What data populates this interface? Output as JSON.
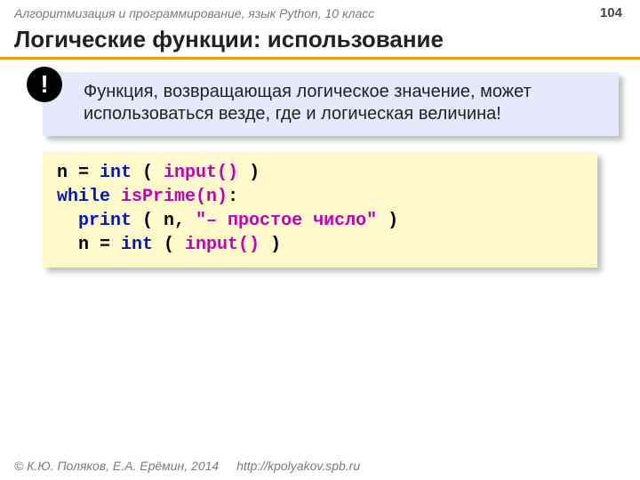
{
  "header": {
    "course": "Алгоритмизация и программирование, язык Python, 10 класс",
    "page": "104"
  },
  "title": "Логические функции: использование",
  "callout": {
    "bang": "!",
    "text": "Функция, возвращающая логическое значение, может использоваться везде, где и логическая величина!"
  },
  "code": {
    "l1": {
      "a": "n = ",
      "b": "int",
      "c": " ( ",
      "d": "input()",
      "e": " )"
    },
    "l2": {
      "a": "while",
      "b": " ",
      "c": "isPrime(n)",
      "d": ":"
    },
    "l3": {
      "a": "  ",
      "b": "print",
      "c": " ( n, ",
      "d": "\"– простое число\"",
      "e": " )"
    },
    "l4": {
      "a": "  n = ",
      "b": "int",
      "c": " ( ",
      "d": "input()",
      "e": " )"
    }
  },
  "footer": {
    "copyright": "© К.Ю. Поляков, Е.А. Ерёмин, 2014",
    "url": "http://kpolyakov.spb.ru"
  }
}
